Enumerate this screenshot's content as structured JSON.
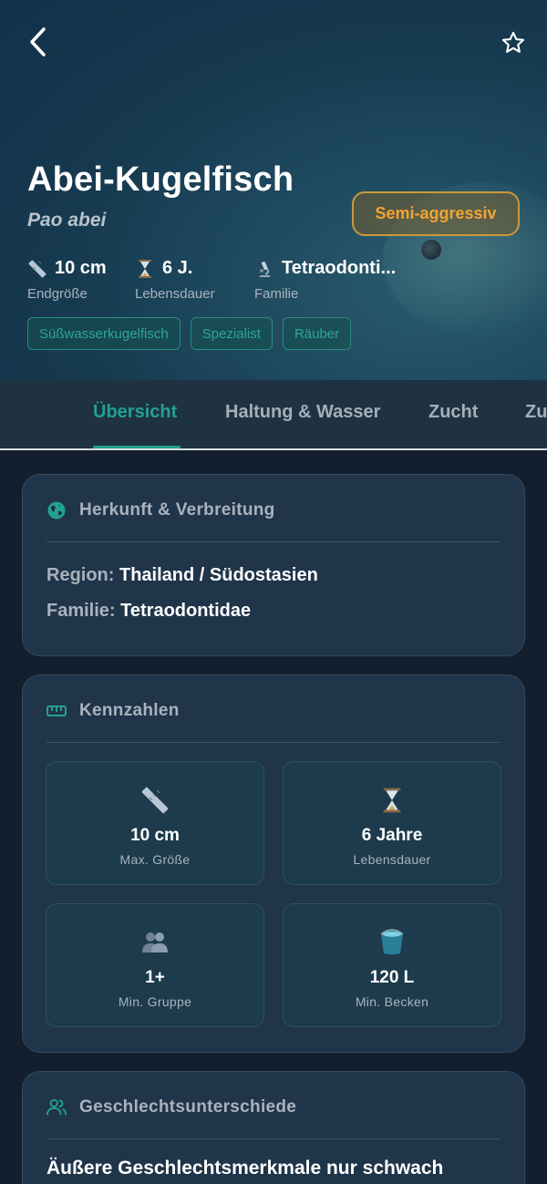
{
  "header": {
    "title": "Abei-Kugelfisch",
    "scientific_name": "Pao abei",
    "temperament_badge": "Semi-aggressiv",
    "back_icon": "chevron-left-icon",
    "favorite_icon": "star-outline-icon"
  },
  "stats": [
    {
      "icon": "ruler-icon",
      "value": "10 cm",
      "label": "Endgröße"
    },
    {
      "icon": "hourglass-icon",
      "value": "6 J.",
      "label": "Lebensdauer"
    },
    {
      "icon": "microscope-icon",
      "value": "Tetraodonti...",
      "label": "Familie"
    }
  ],
  "tags": [
    "Süßwasserkugelfisch",
    "Spezialist",
    "Räuber"
  ],
  "tabs": [
    {
      "label": "Übersicht",
      "active": true
    },
    {
      "label": "Haltung & Wasser",
      "active": false
    },
    {
      "label": "Zucht",
      "active": false
    },
    {
      "label": "Zu",
      "active": false
    }
  ],
  "origin_card": {
    "title": "Herkunft & Verbreitung",
    "icon": "globe-icon",
    "region_label": "Region:",
    "region_value": "Thailand / Südostasien",
    "family_label": "Familie:",
    "family_value": "Tetraodontidae"
  },
  "metrics_card": {
    "title": "Kennzahlen",
    "icon": "ruler-horizontal-icon",
    "tiles": [
      {
        "icon": "ruler-icon",
        "value": "10 cm",
        "label": "Max. Größe"
      },
      {
        "icon": "hourglass-icon",
        "value": "6 Jahre",
        "label": "Lebensdauer"
      },
      {
        "icon": "group-icon",
        "value": "1+",
        "label": "Min. Gruppe"
      },
      {
        "icon": "bucket-icon",
        "value": "120 L",
        "label": "Min. Becken"
      }
    ]
  },
  "sex_card": {
    "title": "Geschlechtsunterschiede",
    "icon": "users-icon",
    "text": "Äußere Geschlechtsmerkmale nur schwach"
  },
  "colors": {
    "accent": "#24a08f",
    "warning": "#f4a531",
    "background": "#131f2e",
    "card": "#20344a"
  }
}
